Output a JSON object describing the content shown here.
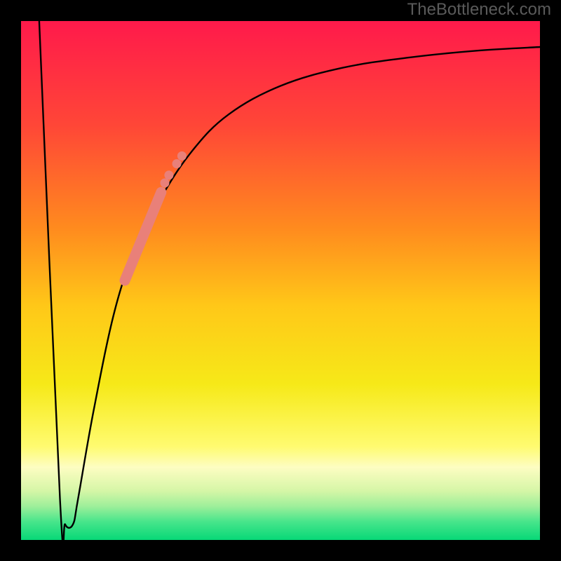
{
  "watermark": "TheBottleneck.com",
  "border": {
    "inner_x": 30,
    "inner_y": 30,
    "inner_w": 740,
    "inner_h": 740
  },
  "chart_data": {
    "type": "line",
    "title": "",
    "xlabel": "",
    "ylabel": "",
    "xlim": [
      0,
      100
    ],
    "ylim": [
      0,
      100
    ],
    "curve": [
      {
        "x": 3.5,
        "y": 100
      },
      {
        "x": 7.5,
        "y": 8
      },
      {
        "x": 8.5,
        "y": 3
      },
      {
        "x": 10.0,
        "y": 3
      },
      {
        "x": 11.0,
        "y": 8
      },
      {
        "x": 14.0,
        "y": 25
      },
      {
        "x": 18.0,
        "y": 44
      },
      {
        "x": 22.0,
        "y": 56
      },
      {
        "x": 27.0,
        "y": 66
      },
      {
        "x": 33.0,
        "y": 75
      },
      {
        "x": 40.0,
        "y": 82
      },
      {
        "x": 50.0,
        "y": 87.5
      },
      {
        "x": 62.0,
        "y": 91
      },
      {
        "x": 75.0,
        "y": 93
      },
      {
        "x": 88.0,
        "y": 94.3
      },
      {
        "x": 100.0,
        "y": 95
      }
    ],
    "highlight_band": {
      "start": {
        "x": 20.0,
        "y": 50
      },
      "end": {
        "x": 27.0,
        "y": 67
      },
      "thick": true
    },
    "highlight_points": [
      {
        "x": 27.7,
        "y": 68.8
      },
      {
        "x": 28.5,
        "y": 70.3
      },
      {
        "x": 30.0,
        "y": 72.5
      },
      {
        "x": 31.0,
        "y": 74.0
      }
    ],
    "gradient_stops": [
      {
        "offset": 0.0,
        "color": "#ff1a4b"
      },
      {
        "offset": 0.2,
        "color": "#ff4637"
      },
      {
        "offset": 0.4,
        "color": "#ff8b1e"
      },
      {
        "offset": 0.55,
        "color": "#ffc818"
      },
      {
        "offset": 0.7,
        "color": "#f6e918"
      },
      {
        "offset": 0.82,
        "color": "#fffb70"
      },
      {
        "offset": 0.86,
        "color": "#fdfdc2"
      },
      {
        "offset": 0.905,
        "color": "#d6f6a7"
      },
      {
        "offset": 0.935,
        "color": "#9eef9a"
      },
      {
        "offset": 0.965,
        "color": "#47e58b"
      },
      {
        "offset": 1.0,
        "color": "#07d877"
      }
    ],
    "curve_color": "#000000",
    "highlight_color": "#e98079"
  }
}
